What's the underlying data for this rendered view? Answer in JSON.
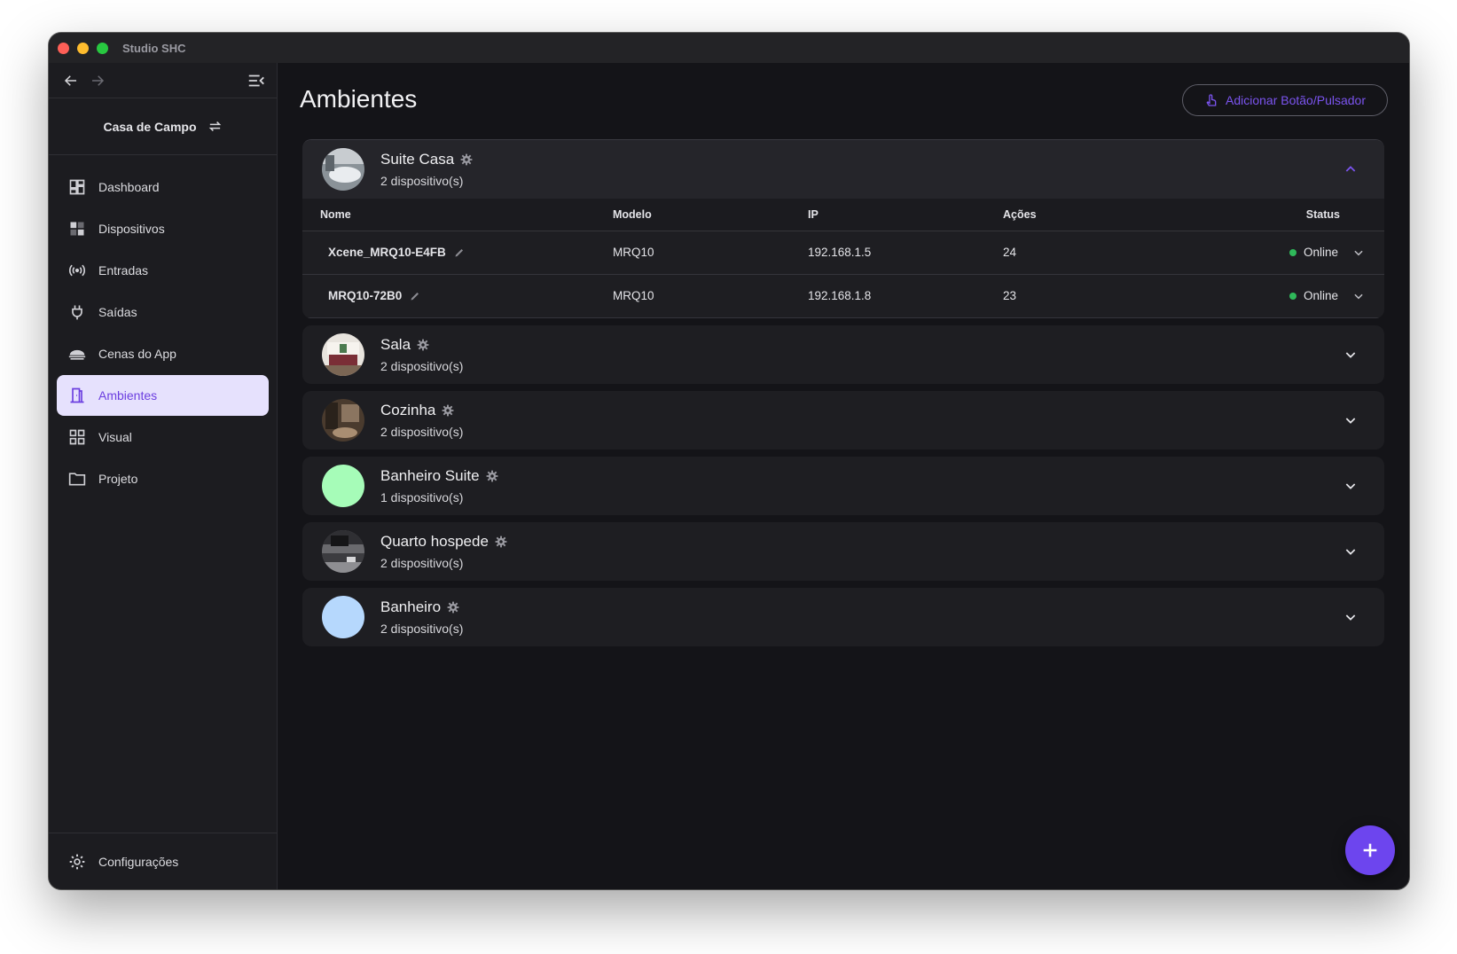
{
  "window": {
    "title": "Studio SHC"
  },
  "sidebar": {
    "project": "Casa de Campo",
    "items": [
      {
        "label": "Dashboard",
        "icon": "dashboard-icon",
        "active": false
      },
      {
        "label": "Dispositivos",
        "icon": "devices-icon",
        "active": false
      },
      {
        "label": "Entradas",
        "icon": "broadcast-icon",
        "active": false
      },
      {
        "label": "Saídas",
        "icon": "plug-icon",
        "active": false
      },
      {
        "label": "Cenas do App",
        "icon": "scene-icon",
        "active": false
      },
      {
        "label": "Ambientes",
        "icon": "door-icon",
        "active": true
      },
      {
        "label": "Visual",
        "icon": "grid-icon",
        "active": false
      },
      {
        "label": "Projeto",
        "icon": "folder-icon",
        "active": false
      }
    ],
    "footer": {
      "label": "Configurações",
      "icon": "gear-icon"
    }
  },
  "main": {
    "title": "Ambientes",
    "add_button": "Adicionar Botão/Pulsador",
    "table_headers": {
      "name": "Nome",
      "model": "Modelo",
      "ip": "IP",
      "actions": "Ações",
      "status": "Status"
    },
    "rooms": [
      {
        "name": "Suite Casa",
        "count": "2 dispositivo(s)",
        "expanded": true,
        "devices": [
          {
            "name": "Xcene_MRQ10-E4FB",
            "model": "MRQ10",
            "ip": "192.168.1.5",
            "actions": "24",
            "status": "Online"
          },
          {
            "name": "MRQ10-72B0",
            "model": "MRQ10",
            "ip": "192.168.1.8",
            "actions": "23",
            "status": "Online"
          }
        ]
      },
      {
        "name": "Sala",
        "count": "2 dispositivo(s)"
      },
      {
        "name": "Cozinha",
        "count": "2 dispositivo(s)"
      },
      {
        "name": "Banheiro Suite",
        "count": "1 dispositivo(s)",
        "color": "#a6fcb8"
      },
      {
        "name": "Quarto hospede",
        "count": "2 dispositivo(s)"
      },
      {
        "name": "Banheiro",
        "count": "2 dispositivo(s)",
        "color": "#b6d8fd"
      }
    ]
  },
  "colors": {
    "accent": "#6d45ee",
    "active_bg": "#e6e1fd",
    "online": "#2fb95a"
  }
}
